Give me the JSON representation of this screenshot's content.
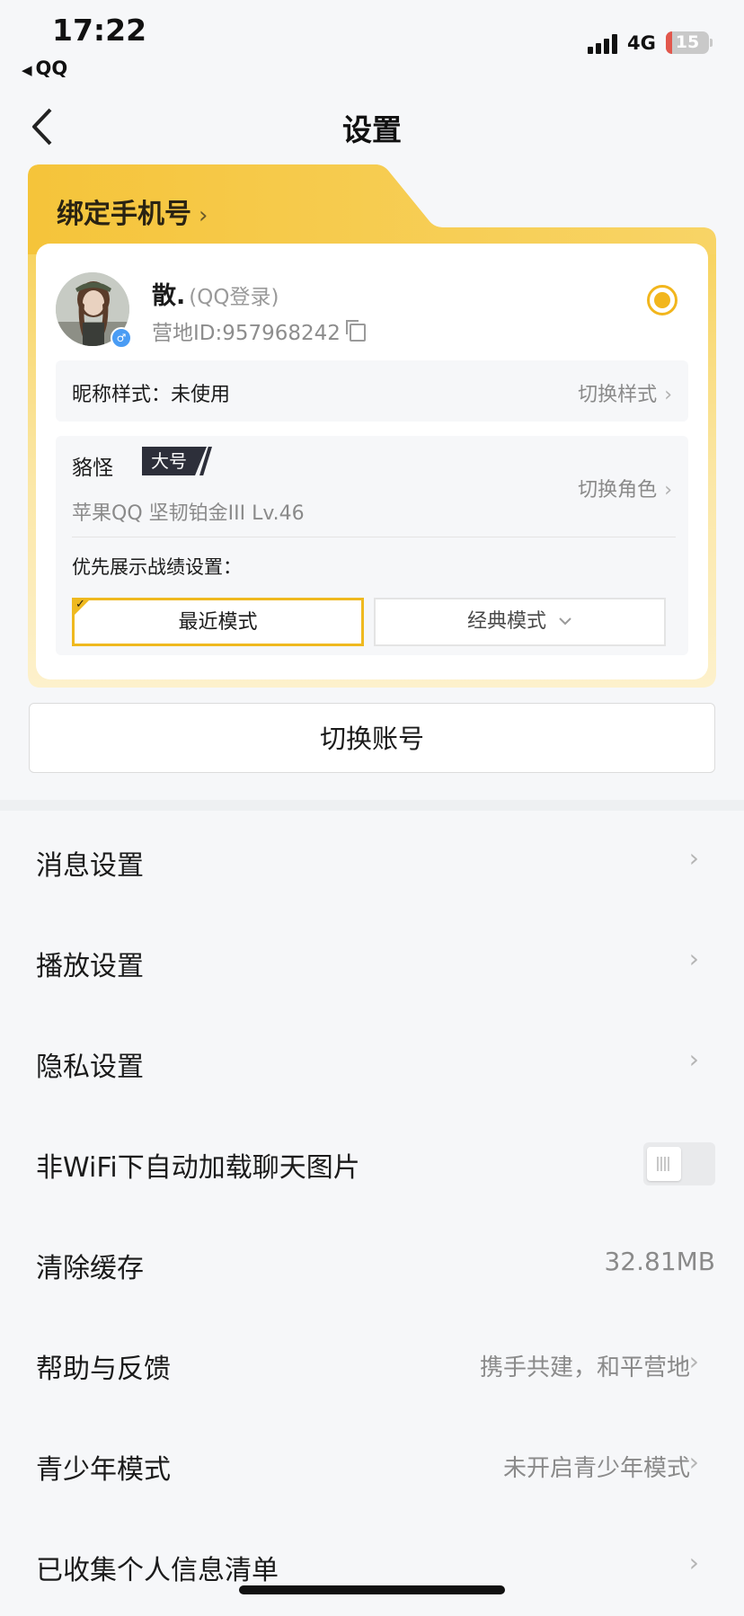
{
  "status_bar": {
    "time": "17:22",
    "back_app": "QQ",
    "network": "4G",
    "battery": "15",
    "battery_level": 0.15
  },
  "nav": {
    "title": "设置",
    "back_icon": "chevron-left-icon"
  },
  "account_card": {
    "bind_phone": "绑定手机号",
    "nickname": "散.",
    "login_type": "(QQ登录)",
    "camp_id": "营地ID:957968242",
    "selected": true,
    "nick_style_label": "昵称样式：未使用",
    "switch_style": "切换样式",
    "role_name": "貉怪",
    "role_tag": "大号",
    "role_info": "苹果QQ  坚韧铂金III  Lv.46",
    "switch_role": "切换角色",
    "priority_label": "优先展示战绩设置：",
    "mode_recent": "最近模式",
    "mode_classic": "经典模式",
    "accent_color": "#f2b61d"
  },
  "switch_account": "切换账号",
  "settings": [
    {
      "title": "消息设置",
      "value": "",
      "type": "link"
    },
    {
      "title": "播放设置",
      "value": "",
      "type": "link"
    },
    {
      "title": "隐私设置",
      "value": "",
      "type": "link"
    },
    {
      "title": "非WiFi下自动加载聊天图片",
      "value": "",
      "type": "toggle",
      "on": false
    },
    {
      "title": "清除缓存",
      "value": "32.81MB",
      "type": "value"
    },
    {
      "title": "帮助与反馈",
      "value": "携手共建，和平营地",
      "type": "link"
    },
    {
      "title": "青少年模式",
      "value": "未开启青少年模式",
      "type": "link"
    },
    {
      "title": "已收集个人信息清单",
      "value": "",
      "type": "link"
    }
  ]
}
